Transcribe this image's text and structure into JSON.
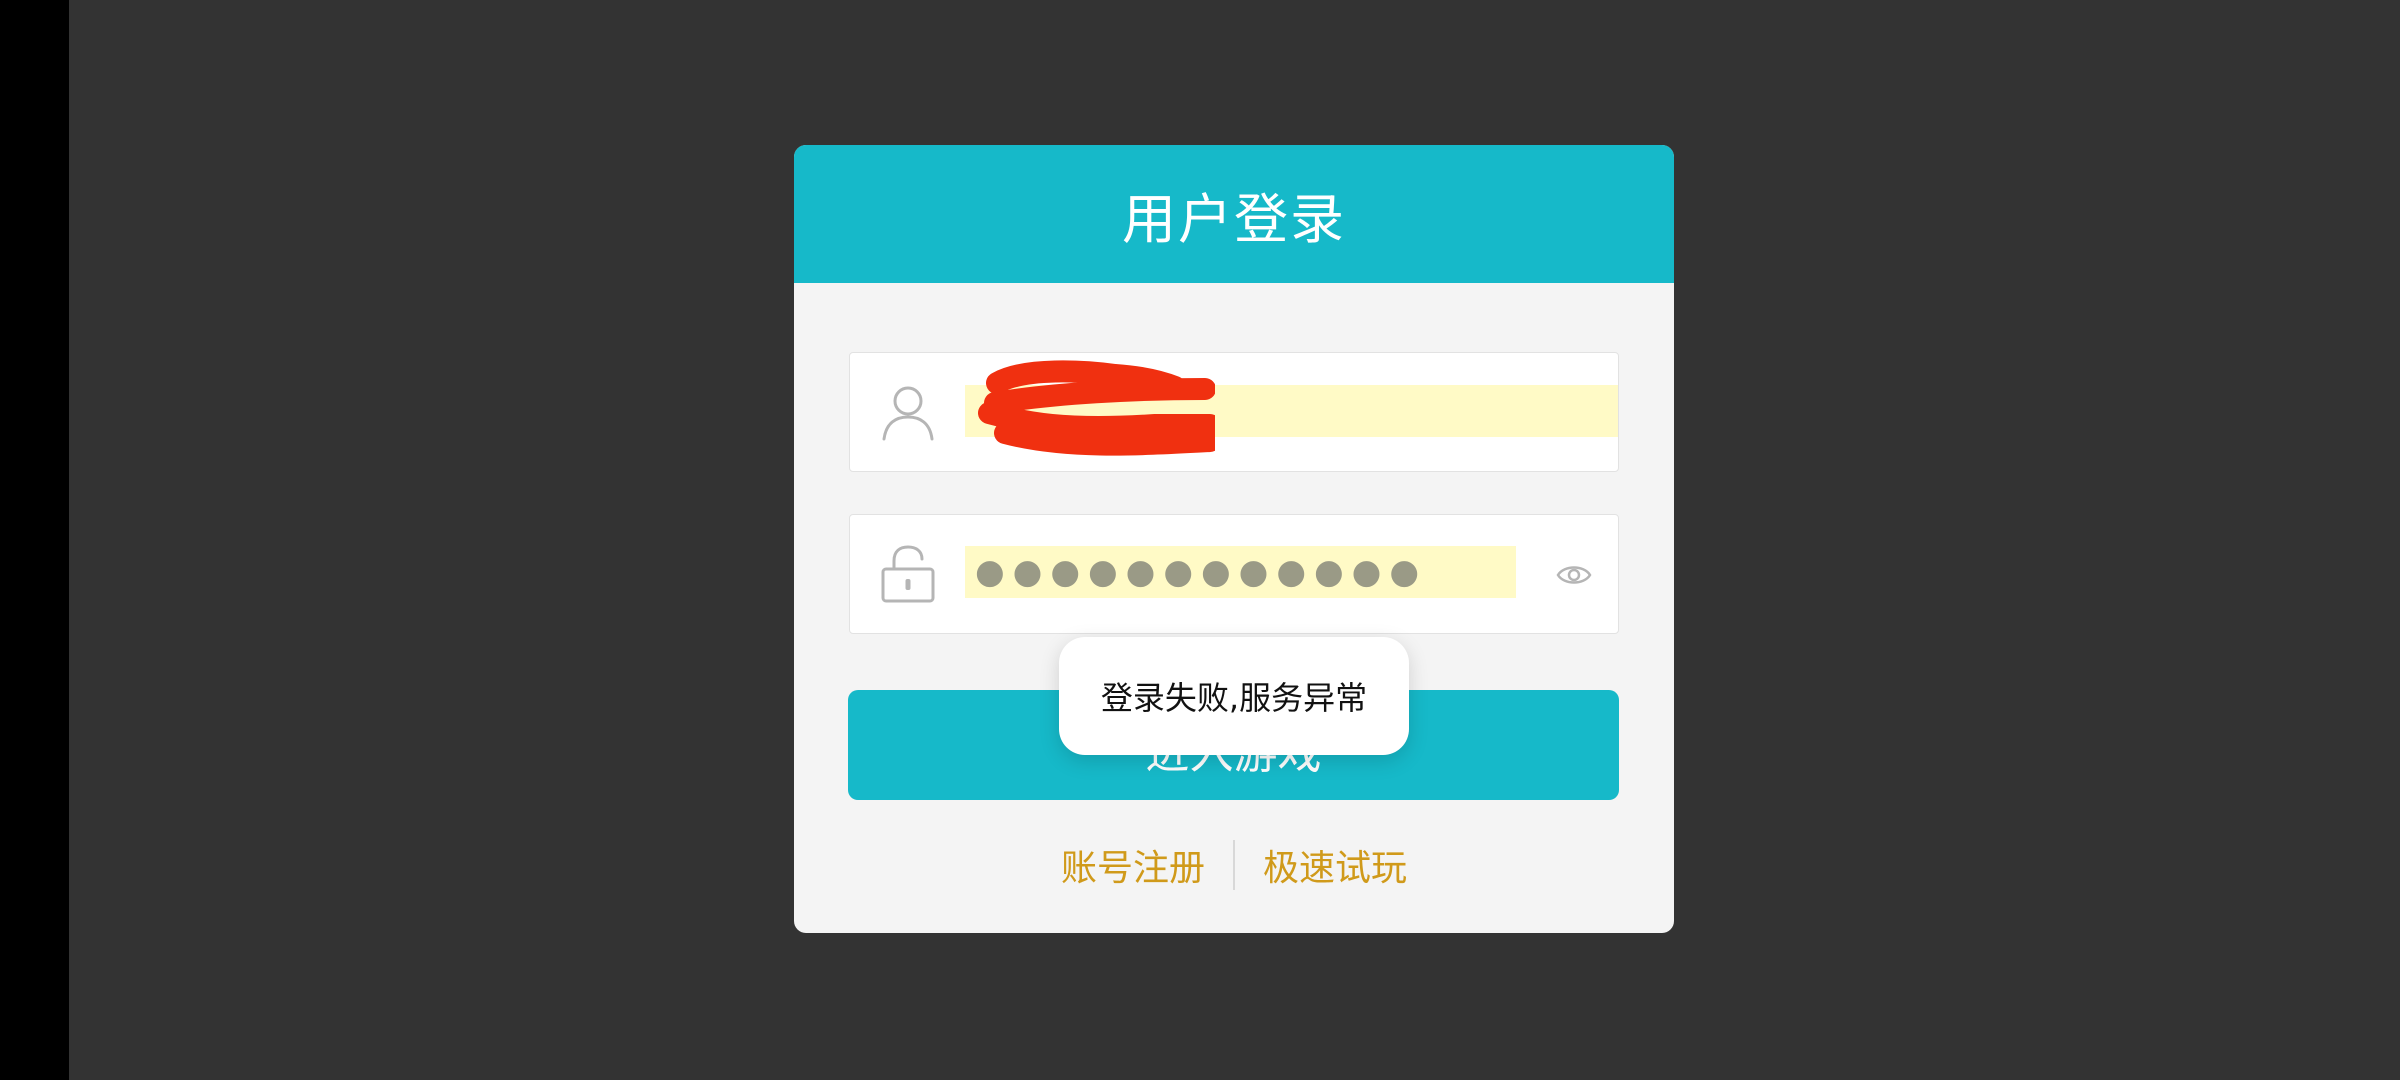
{
  "dialog": {
    "title": "用户登录"
  },
  "username_field": {
    "value_redacted": true,
    "icon": "user-icon"
  },
  "password_field": {
    "masked_value": "●●●●●●●●●●●●",
    "icon": "unlock-icon",
    "visibility_icon": "eye-icon"
  },
  "login_button": {
    "label": "进入游戏"
  },
  "links": {
    "register": "账号注册",
    "quick_play": "极速试玩"
  },
  "toast": {
    "message": "登录失败,服务异常"
  },
  "colors": {
    "accent": "#16b9c9",
    "link": "#d09a1a",
    "background": "#333333",
    "autofill": "#fffac6",
    "redaction": "#f03010"
  }
}
